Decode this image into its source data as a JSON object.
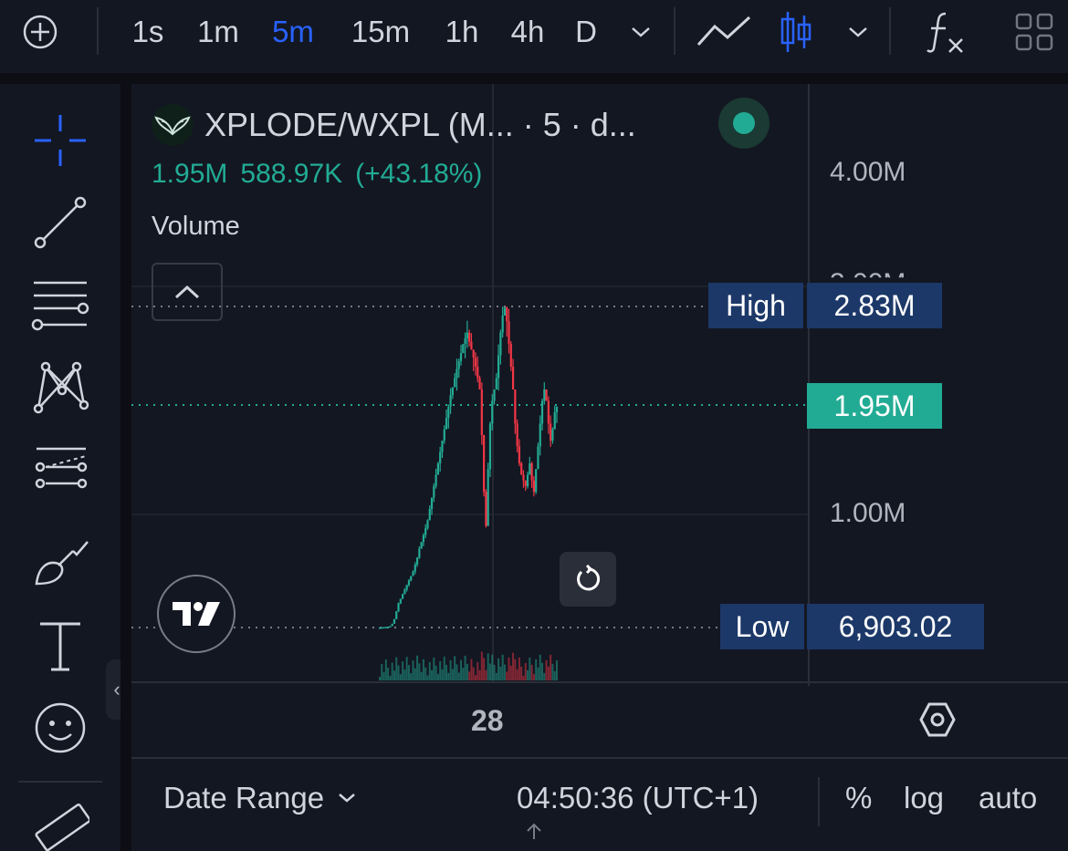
{
  "toolbar": {
    "intervals": [
      "1s",
      "1m",
      "5m",
      "15m",
      "1h",
      "4h",
      "D"
    ],
    "active_interval": "5m",
    "icons": [
      "add-symbol-icon",
      "chevron-down-icon",
      "line-chart-icon",
      "candlestick-icon",
      "chevron-down-icon",
      "indicators-fx-icon",
      "layout-grid-icon"
    ]
  },
  "sidebar": {
    "tools": [
      "crosshair-icon",
      "trend-line-icon",
      "fib-levels-icon",
      "pattern-icon",
      "forecast-icon",
      "brush-icon",
      "text-icon",
      "emoji-icon",
      "ruler-icon"
    ],
    "collapse_glyph": "‹"
  },
  "legend": {
    "symbol": "XPLODE/WXPL (M...  · 5 · d...",
    "ohlc": [
      "1.95M",
      "588.97K",
      "(+43.18%)"
    ],
    "volume_label": "Volume"
  },
  "price_axis": {
    "labels": [
      "4.00M",
      "3.00M",
      "1.00M"
    ]
  },
  "markers": {
    "high_label": "High",
    "high_value": "2.83M",
    "last_value": "1.95M",
    "low_label": "Low",
    "low_value": "6,903.02"
  },
  "time_axis": {
    "label": "28"
  },
  "bottom_bar": {
    "date_range": "Date Range",
    "clock": "04:50:36 (UTC+1)",
    "percent": "%",
    "log": "log",
    "auto": "auto"
  },
  "colors": {
    "background": "#131722",
    "up": "#22ab94",
    "down": "#f23645",
    "accent": "#2962ff",
    "marker": "#1c3868"
  },
  "chart_data": {
    "type": "candlestick",
    "y_scale": "linear",
    "ylim": [
      0,
      4300000
    ],
    "close_series": [
      7000,
      9000,
      11000,
      12000,
      15000,
      20000,
      40000,
      80000,
      150000,
      220000,
      260000,
      300000,
      340000,
      380000,
      420000,
      460000,
      500000,
      560000,
      620000,
      700000,
      760000,
      820000,
      880000,
      950000,
      1050000,
      1150000,
      1250000,
      1350000,
      1450000,
      1550000,
      1650000,
      1750000,
      1850000,
      1950000,
      2050000,
      2120000,
      2200000,
      2280000,
      2350000,
      2420000,
      2500000,
      2550000,
      2600000,
      2520000,
      2450000,
      2380000,
      2300000,
      2200000,
      2100000,
      1700000,
      1200000,
      900000,
      1400000,
      1800000,
      2000000,
      2100000,
      2200000,
      2400000,
      2600000,
      2750000,
      2820000,
      2700000,
      2500000,
      2300000,
      2100000,
      1800000,
      1600000,
      1450000,
      1350000,
      1300000,
      1250000,
      1350000,
      1450000,
      1300000,
      1200000,
      1400000,
      1600000,
      1800000,
      2000000,
      2100000,
      2000000,
      1800000,
      1650000,
      1750000,
      1900000,
      1950000
    ],
    "high": 2830000,
    "low": 6903.02,
    "last": 1950000
  }
}
